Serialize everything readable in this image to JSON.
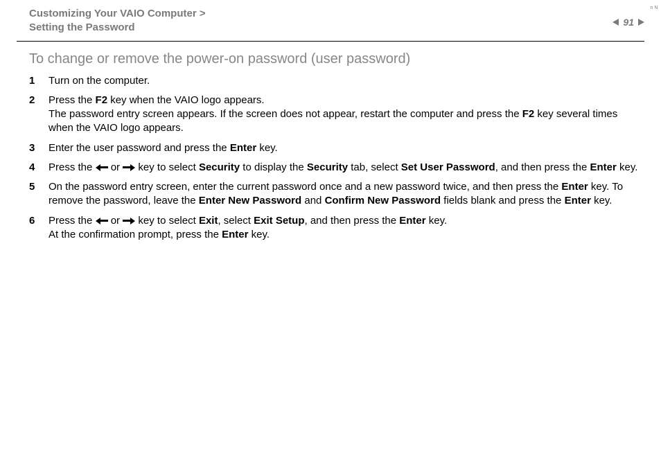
{
  "header": {
    "breadcrumb_line1": "Customizing Your VAIO Computer >",
    "breadcrumb_line2": "Setting the Password",
    "page_number": "91",
    "n_marker": "n N"
  },
  "section_title": "To change or remove the power-on password (user password)",
  "steps": {
    "s1": {
      "t1": "Turn on the computer."
    },
    "s2": {
      "t1": "Press the ",
      "b1": "F2",
      "t2": " key when the VAIO logo appears.",
      "t3": "The password entry screen appears. If the screen does not appear, restart the computer and press the ",
      "b2": "F2",
      "t4": " key several times when the VAIO logo appears."
    },
    "s3": {
      "t1": "Enter the user password and press the ",
      "b1": "Enter",
      "t2": " key."
    },
    "s4": {
      "t1": "Press the ",
      "t2": " or ",
      "t3": " key to select ",
      "b1": "Security",
      "t4": " to display the ",
      "b2": "Security",
      "t5": " tab, select ",
      "b3": "Set User Password",
      "t6": ", and then press the ",
      "b4": "Enter",
      "t7": " key."
    },
    "s5": {
      "t1": "On the password entry screen, enter the current password once and a new password twice, and then press the ",
      "b1": "Enter",
      "t2": " key.",
      "t3": "To remove the password, leave the ",
      "b2": "Enter New Password",
      "t4": " and ",
      "b3": "Confirm New Password",
      "t5": " fields blank and press the ",
      "b4": "Enter",
      "t6": " key."
    },
    "s6": {
      "t1": "Press the ",
      "t2": " or ",
      "t3": " key to select ",
      "b1": "Exit",
      "t4": ", select ",
      "b2": "Exit Setup",
      "t5": ", and then press the ",
      "b3": "Enter",
      "t6": " key.",
      "t7": "At the confirmation prompt, press the ",
      "b4": "Enter",
      "t8": " key."
    }
  }
}
